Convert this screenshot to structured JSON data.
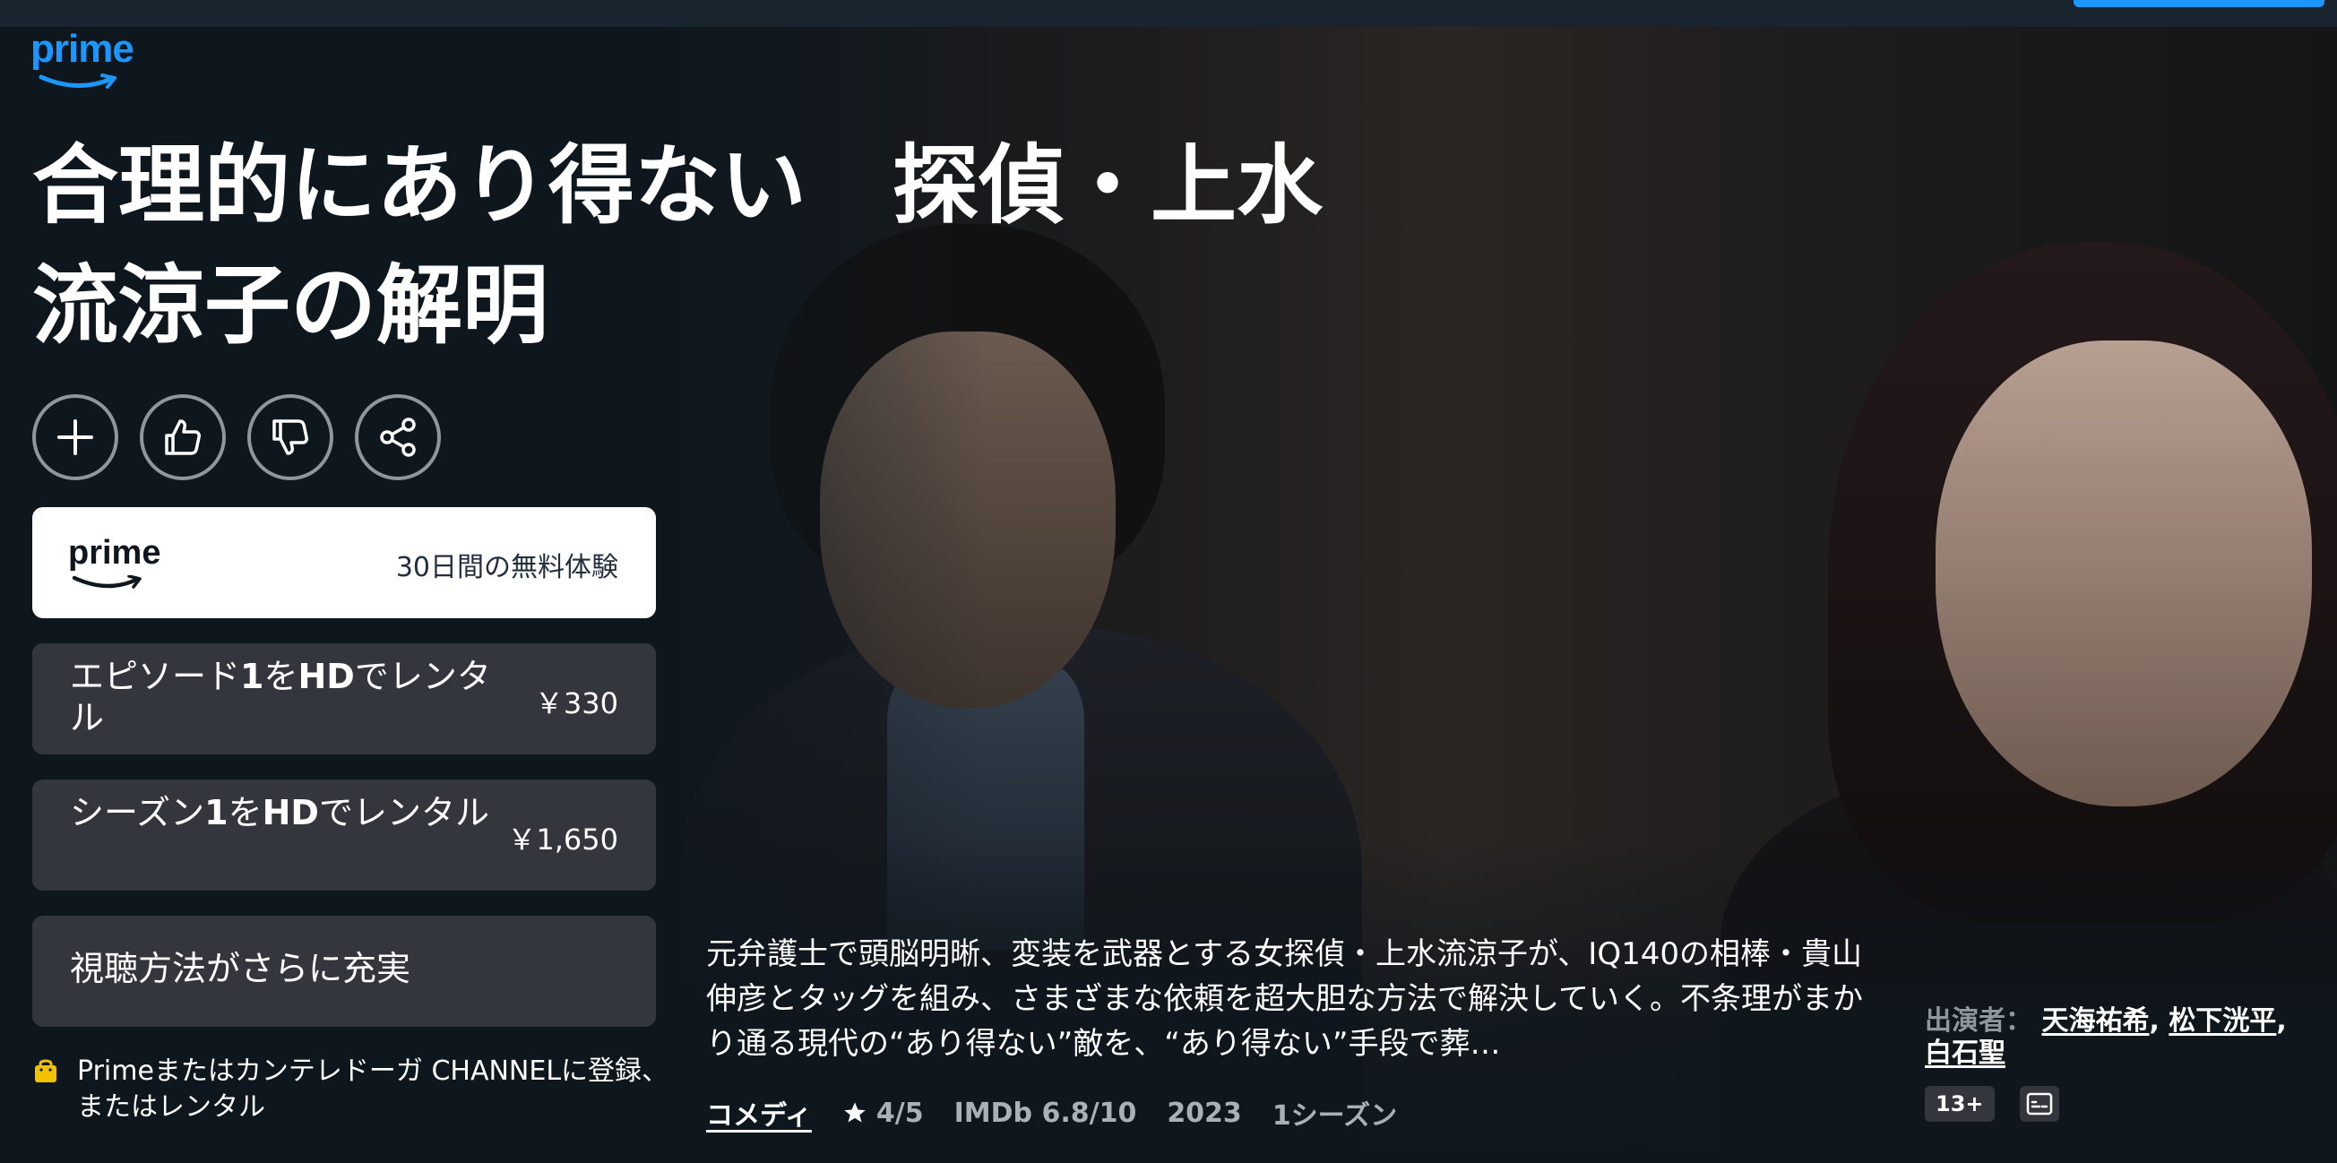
{
  "brand": {
    "logo_text": "prime",
    "accent_color": "#1a98ff"
  },
  "title": {
    "line1": "合理的にあり得ない　探偵・上水",
    "line2": "流涼子の解明"
  },
  "actions": [
    {
      "icon": "plus-icon",
      "label": ""
    },
    {
      "icon": "thumbs-up-icon",
      "label": ""
    },
    {
      "icon": "thumbs-down-icon",
      "label": ""
    },
    {
      "icon": "share-icon",
      "label": ""
    }
  ],
  "offers": {
    "prime": {
      "logo_text": "prime",
      "text": "30日間の無料体験"
    },
    "episode": {
      "label_pre": "エピソード",
      "label_b1": "1",
      "label_mid": "を",
      "label_b2": "HD",
      "label_post": "でレンタル",
      "price": "￥330"
    },
    "season": {
      "label_pre": "シーズン",
      "label_b1": "1",
      "label_mid": "を",
      "label_b2": "HD",
      "label_post": "でレンタル",
      "price": "￥1,650"
    },
    "more": {
      "label": "視聴方法がさらに充実"
    }
  },
  "note": {
    "icon": "shopping-bag-icon",
    "text": "Primeまたはカンテレドーガ CHANNELに登録、またはレンタル"
  },
  "synopsis": "元弁護士で頭脳明晰、変装を武器とする女探偵・上水流涼子が、IQ140の相棒・貴山伸彦とタッグを組み、さまざまな依頼を超大胆な方法で解決していく。不条理がまかり通る現代の“あり得ない”敵を、“あり得ない”手段で葬…",
  "meta": {
    "genre": "コメディ",
    "rating_icon": "star-icon",
    "rating": "4/5",
    "imdb": "IMDb 6.8/10",
    "year": "2023",
    "seasons": "1シーズン"
  },
  "cast": {
    "label": "出演者：",
    "names": [
      "天海祐希",
      "松下洸平",
      "白石聖"
    ],
    "sep": ","
  },
  "badges": {
    "age": "13+",
    "subtitle_icon": "subtitles-icon"
  }
}
